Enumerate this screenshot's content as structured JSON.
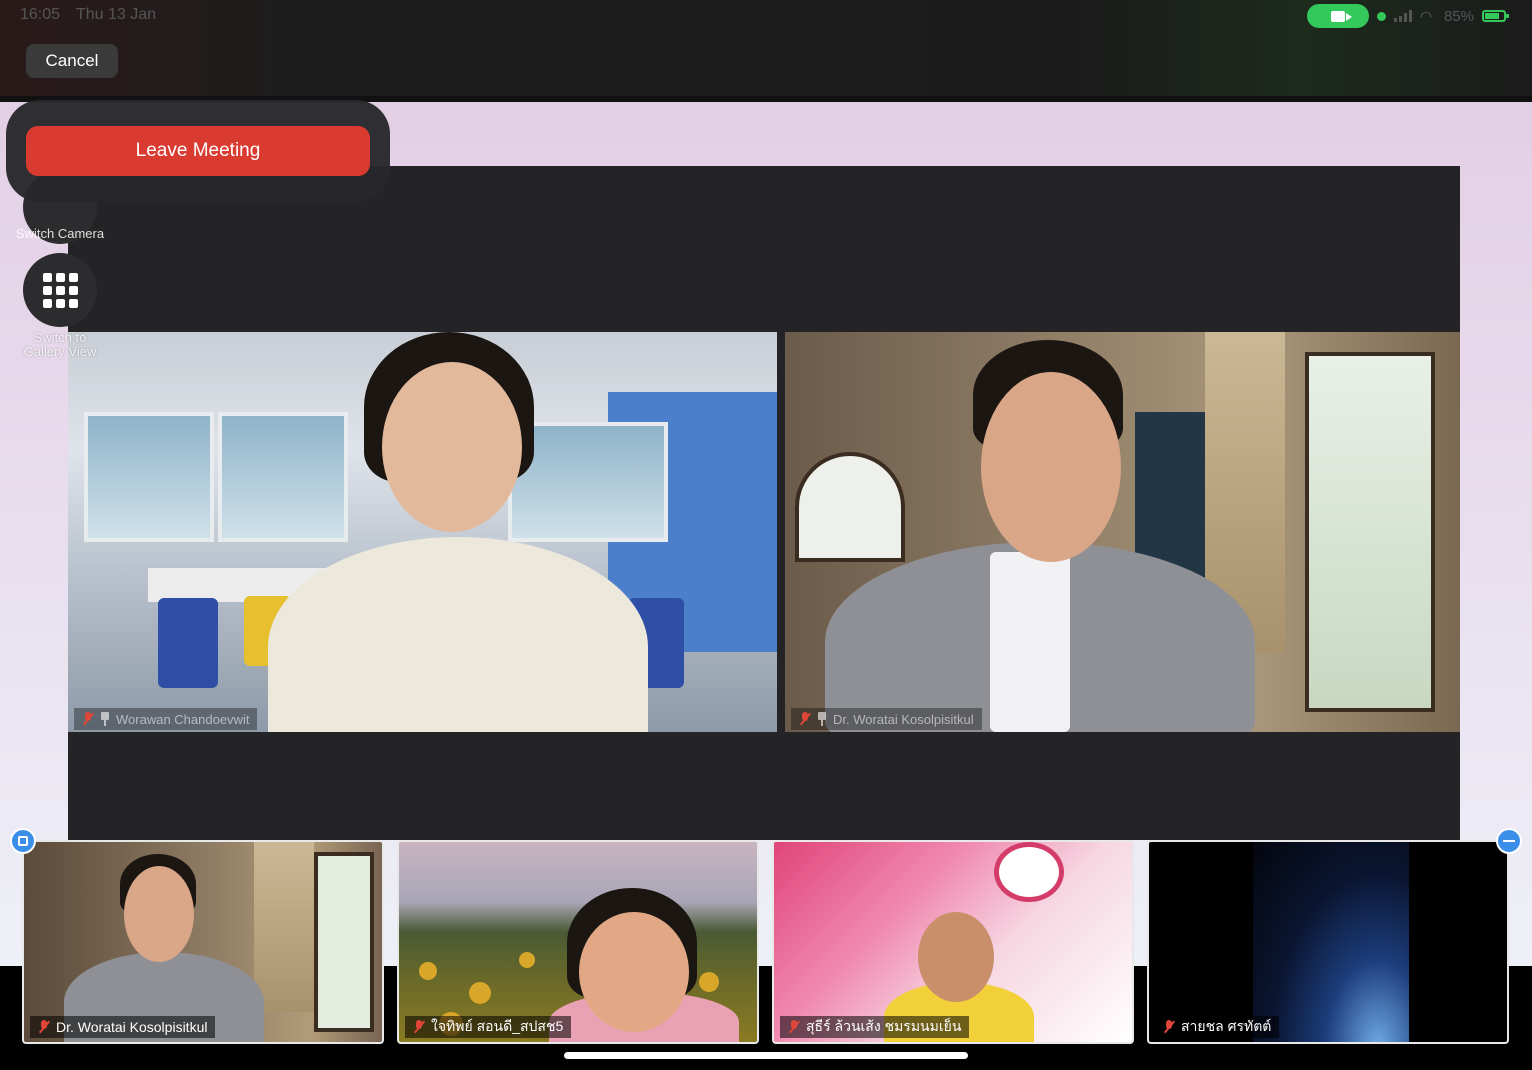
{
  "status_bar": {
    "time": "16:05",
    "date": "Thu 13 Jan",
    "battery": "85%",
    "accent_green": "#34c759"
  },
  "top_bar": {
    "cancel_label": "Cancel"
  },
  "popover": {
    "leave_label": "Leave Meeting",
    "leave_color": "#d93b30"
  },
  "side_controls": {
    "switch_camera_label": "Switch Camera",
    "gallery_label_line1": "Switch to",
    "gallery_label_line2": "Gallery View",
    "gallery_icon": "grid-icon"
  },
  "main_videos": [
    {
      "name": "Worawan Chandoevwit",
      "muted": true,
      "pinned": true
    },
    {
      "name": "Dr. Woratai Kosolpisitkul",
      "muted": true,
      "pinned": true
    }
  ],
  "thumbnails": [
    {
      "name": "Dr. Woratai Kosolpisitkul",
      "muted": true
    },
    {
      "name": "ใจทิพย์ สอนดี_สปสช5",
      "muted": true
    },
    {
      "name": "สุธีร์ ล้วนเส้ง ชมรมนมเย็น",
      "muted": true
    },
    {
      "name": "สายชล ศรทัตต์",
      "muted": true
    }
  ]
}
